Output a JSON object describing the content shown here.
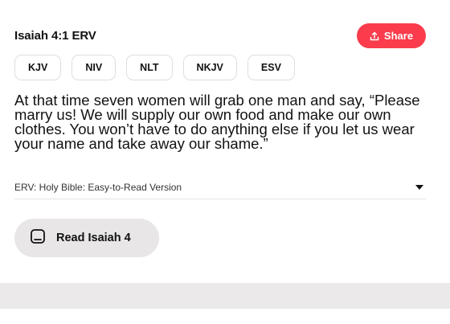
{
  "reference": {
    "title": "Isaiah 4:1 ERV"
  },
  "share": {
    "label": "Share",
    "icon": "share-icon",
    "color": "#fa3c4c"
  },
  "versions": [
    "KJV",
    "NIV",
    "NLT",
    "NKJV",
    "ESV"
  ],
  "verse": {
    "text": "At that time seven women will grab one man and say, “Please marry us! We will supply our own food and make our own clothes. You won’t have to do anything else if you let us wear your name and take away our shame.”"
  },
  "version_select": {
    "label": "ERV: Holy Bible: Easy-to-Read Version",
    "icon": "caret-down-icon"
  },
  "read_button": {
    "label": "Read Isaiah 4",
    "icon": "book-icon"
  }
}
